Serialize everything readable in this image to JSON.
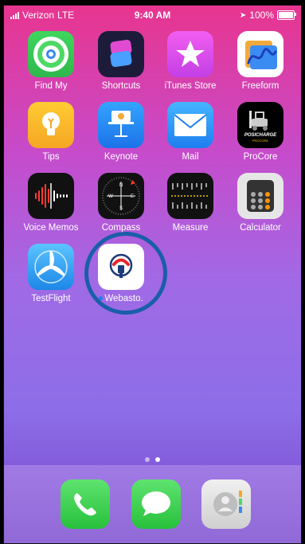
{
  "status_bar": {
    "carrier": "Verizon",
    "network": "LTE",
    "time": "9:40 AM",
    "battery": "100%"
  },
  "apps": [
    {
      "name": "Find My",
      "icon": "find-my-icon"
    },
    {
      "name": "Shortcuts",
      "icon": "shortcuts-icon"
    },
    {
      "name": "iTunes Store",
      "icon": "itunes-store-icon"
    },
    {
      "name": "Freeform",
      "icon": "freeform-icon"
    },
    {
      "name": "Tips",
      "icon": "tips-icon"
    },
    {
      "name": "Keynote",
      "icon": "keynote-icon"
    },
    {
      "name": "Mail",
      "icon": "mail-icon"
    },
    {
      "name": "ProCore",
      "icon": "procore-icon",
      "badge_text": "POSICHARGE",
      "badge_sub": "PROCORE"
    },
    {
      "name": "Voice Memos",
      "icon": "voice-memos-icon"
    },
    {
      "name": "Compass",
      "icon": "compass-icon"
    },
    {
      "name": "Measure",
      "icon": "measure-icon"
    },
    {
      "name": "Calculator",
      "icon": "calculator-icon"
    },
    {
      "name": "TestFlight",
      "icon": "testflight-icon"
    },
    {
      "name": "Webasto.",
      "icon": "webasto-icon",
      "new_dot": true
    }
  ],
  "page_indicator": {
    "pages": 2,
    "current": 2
  },
  "dock": [
    {
      "name": "Phone",
      "icon": "phone-icon"
    },
    {
      "name": "Messages",
      "icon": "messages-icon"
    },
    {
      "name": "Contacts",
      "icon": "contacts-icon"
    }
  ],
  "colors": {
    "highlight_ring": "#1a5ea8",
    "wallpaper_top": "#e8358f",
    "wallpaper_bottom": "#6f45c8"
  }
}
